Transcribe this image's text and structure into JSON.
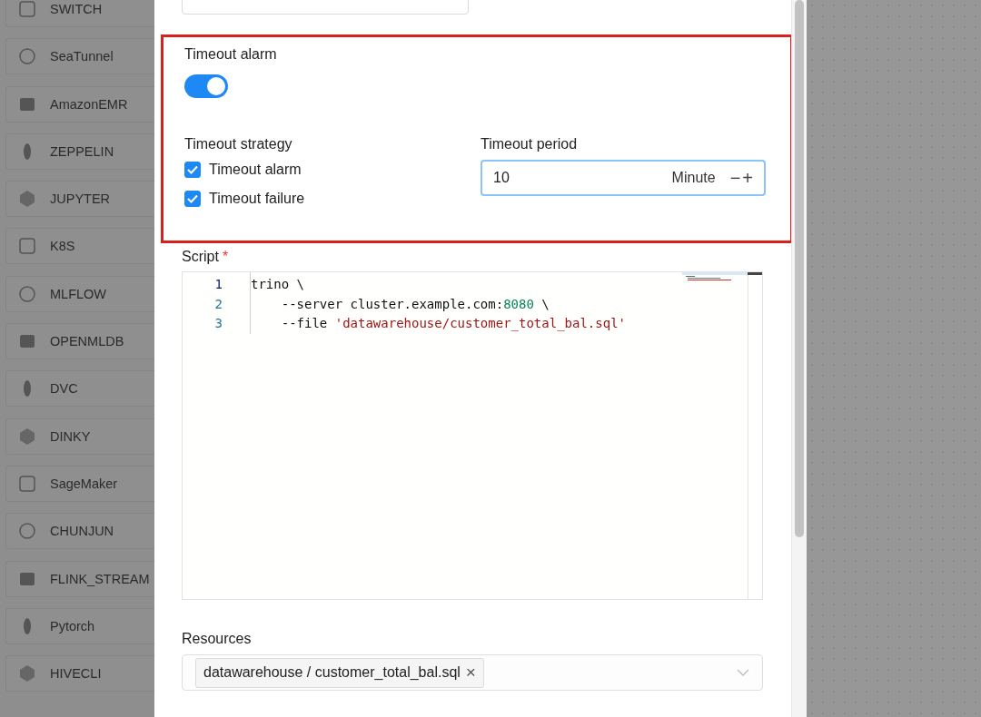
{
  "sidebar": {
    "items": [
      {
        "label": "SWITCH"
      },
      {
        "label": "SeaTunnel"
      },
      {
        "label": "AmazonEMR"
      },
      {
        "label": "ZEPPELIN"
      },
      {
        "label": "JUPYTER"
      },
      {
        "label": "K8S"
      },
      {
        "label": "MLFLOW"
      },
      {
        "label": "OPENMLDB"
      },
      {
        "label": "DVC"
      },
      {
        "label": "DINKY"
      },
      {
        "label": "SageMaker"
      },
      {
        "label": "CHUNJUN"
      },
      {
        "label": "FLINK_STREAM"
      },
      {
        "label": "Pytorch"
      },
      {
        "label": "HIVECLI"
      }
    ]
  },
  "form": {
    "timeout_alarm": {
      "label": "Timeout alarm",
      "on": true
    },
    "timeout_strategy": {
      "label": "Timeout strategy",
      "options": [
        {
          "label": "Timeout alarm",
          "checked": true
        },
        {
          "label": "Timeout failure",
          "checked": true
        }
      ]
    },
    "timeout_period": {
      "label": "Timeout period",
      "value": "10",
      "unit": "Minute",
      "minus": "−",
      "plus": "+"
    },
    "script": {
      "label": "Script",
      "required_mark": "*",
      "lines": [
        {
          "number": "1",
          "tokens": [
            {
              "kind": "plain",
              "text": "trino \\"
            }
          ]
        },
        {
          "number": "2",
          "tokens": [
            {
              "kind": "plain",
              "text": "    --server cluster.example.com:"
            },
            {
              "kind": "number",
              "text": "8080"
            },
            {
              "kind": "plain",
              "text": " \\"
            }
          ]
        },
        {
          "number": "3",
          "tokens": [
            {
              "kind": "plain",
              "text": "    --file "
            },
            {
              "kind": "string",
              "text": "'datawarehouse/customer_total_bal.sql'"
            }
          ]
        }
      ]
    },
    "resources": {
      "label": "Resources",
      "tags": [
        {
          "text": "datawarehouse / customer_total_bal.sql",
          "remove": "×"
        }
      ]
    }
  }
}
